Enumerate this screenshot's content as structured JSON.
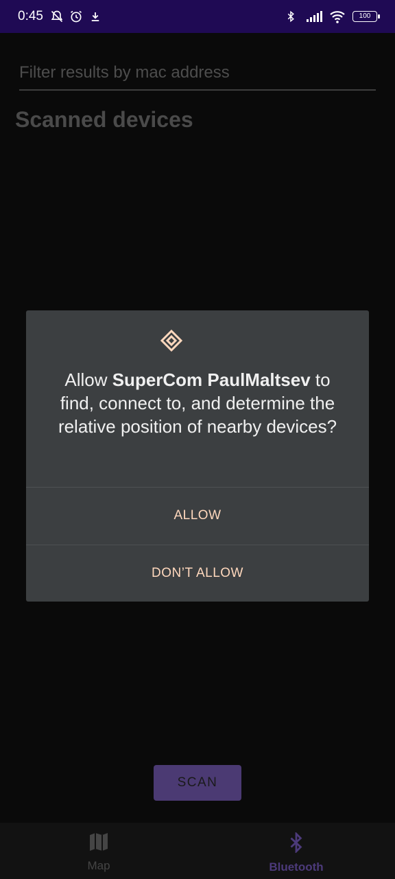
{
  "status_bar": {
    "time": "0:45",
    "battery": "100",
    "icons": [
      "bell-off-icon",
      "alarm-icon",
      "download-icon",
      "bluetooth-icon",
      "signal-icon",
      "wifi-icon",
      "battery-icon"
    ]
  },
  "filter": {
    "placeholder": "Filter results by mac address",
    "value": ""
  },
  "section": {
    "title": "Scanned devices"
  },
  "dialog": {
    "icon": "nearby-devices-icon",
    "message_prefix": "Allow ",
    "app_name": "SuperCom PaulMaltsev",
    "message_suffix": " to find, connect to, and determine the relative position of nearby devices?",
    "allow_label": "ALLOW",
    "deny_label": "DON’T ALLOW",
    "accent_color": "#ffd8bd"
  },
  "scan_button": {
    "label": "SCAN"
  },
  "bottom_nav": {
    "items": [
      {
        "label": "Map",
        "icon": "map-icon",
        "selected": false
      },
      {
        "label": "Bluetooth",
        "icon": "bluetooth-icon",
        "selected": true
      }
    ],
    "accent_color": "#4c3a7a"
  }
}
